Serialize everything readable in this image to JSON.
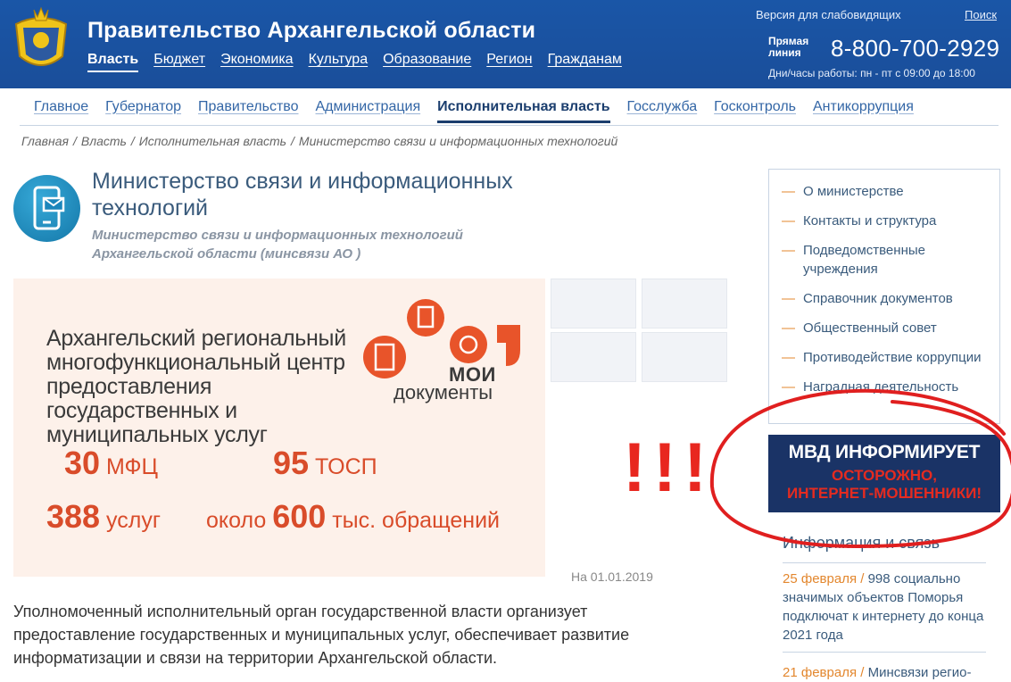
{
  "header": {
    "site_title": "Правительство Архангельской области",
    "nav": [
      "Власть",
      "Бюджет",
      "Экономика",
      "Культура",
      "Образование",
      "Регион",
      "Гражданам"
    ],
    "low_vision": "Версия для слабовидящих",
    "search": "Поиск",
    "hotline_label_1": "Прямая",
    "hotline_label_2": "линия",
    "phone": "8-800-700-2929",
    "hours": "Дни/часы работы: пн - пт с 09:00 до 18:00"
  },
  "secnav": [
    "Главное",
    "Губернатор",
    "Правительство",
    "Администрация",
    "Исполнительная власть",
    "Госслужба",
    "Госконтроль",
    "Антикоррупция"
  ],
  "breadcrumb": [
    "Главная",
    "Власть",
    "Исполнительная власть",
    "Министерство связи и информационных технологий"
  ],
  "page": {
    "title": "Министерство связи и информационных технологий",
    "subtitle": "Министерство связи и информационных технологий Архангельской области (минсвязи АО )",
    "description": "Уполномоченный исполнительный орган государственной власти организует предоставление государственных и муниципальных услуг, обеспечивает развитие информатизации и связи на территории Архангельской области."
  },
  "banner": {
    "text": "Архангельский региональный многофункциональный центр предоставления государственных и муниципальных услуг",
    "brand_1": "МОИ",
    "brand_2": "документы",
    "stat1_num": "30",
    "stat1_unit": "МФЦ",
    "stat2_num": "95",
    "stat2_unit": "ТОСП",
    "stat3_num": "388",
    "stat3_unit": "услуг",
    "stat4_prefix": "около",
    "stat4_num": "600",
    "stat4_unit": "тыс. обращений",
    "date": "На 01.01.2019"
  },
  "annotation": {
    "exclamation": "!!!"
  },
  "sidebar": {
    "items": [
      "О министерстве",
      "Контакты и структура",
      "Подведомственные учреждения",
      "Справочник документов",
      "Общественный совет",
      "Противодействие коррупции",
      "Наградная деятельность"
    ]
  },
  "mvd": {
    "title": "МВД ИНФОРМИРУЕТ",
    "warn_1": "ОСТОРОЖНО,",
    "warn_2": "ИНТЕРНЕТ-МОШЕННИКИ!"
  },
  "info": {
    "title": "Информация и связь",
    "news": [
      {
        "date": "25 февраля",
        "text": "998 социально значимых объектов Поморья подключат к интернету до конца 2021 года"
      },
      {
        "date": "21 февраля",
        "text": "Минсвязи регио-"
      }
    ]
  },
  "colors": {
    "header_blue": "#1a56a7",
    "accent_orange": "#e3872e",
    "stat_red": "#d94c2a",
    "mvd_navy": "#1a3366"
  }
}
